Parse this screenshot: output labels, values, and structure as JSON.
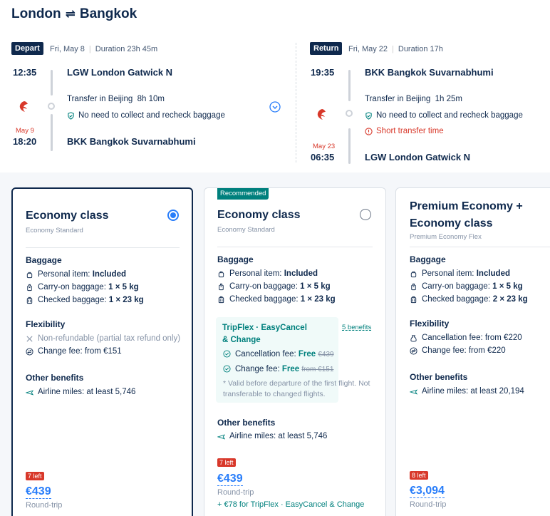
{
  "header": {
    "origin": "London",
    "swap_icon": "⇌",
    "destination": "Bangkok"
  },
  "depart": {
    "tag": "Depart",
    "date": "Fri, May 8",
    "duration": "Duration 23h 45m",
    "dep_time": "12:35",
    "dep_airport": "LGW London Gatwick N",
    "transfer": "Transfer in Beijing",
    "transfer_time": "8h 10m",
    "baggage_note": "No need to collect and recheck baggage",
    "arr_date": "May 9",
    "arr_time": "18:20",
    "arr_airport": "BKK Bangkok Suvarnabhumi"
  },
  "return": {
    "tag": "Return",
    "date": "Fri, May 22",
    "duration": "Duration 17h",
    "dep_time": "19:35",
    "dep_airport": "BKK Bangkok Suvarnabhumi",
    "transfer": "Transfer in Beijing",
    "transfer_time": "1h 25m",
    "baggage_note": "No need to collect and recheck baggage",
    "warning": "Short transfer time",
    "arr_date": "May 23",
    "arr_time": "06:35",
    "arr_airport": "LGW London Gatwick N"
  },
  "fares": [
    {
      "name": "Economy class",
      "subname": "Economy Standard",
      "selected": true,
      "baggage_title": "Baggage",
      "personal_label": "Personal item:",
      "personal_value": "Included",
      "carry_label": "Carry-on baggage:",
      "carry_value": "1 × 5 kg",
      "checked_label": "Checked baggage:",
      "checked_value": "1 × 23 kg",
      "flex_title": "Flexibility",
      "flex_1": "Non-refundable (partial tax refund only)",
      "flex_2": "Change fee: from €151",
      "other_title": "Other benefits",
      "miles": "Airline miles: at least 5,746",
      "seats_left": "7 left",
      "price": "€439",
      "price_note": "Round-trip"
    },
    {
      "name": "Economy class",
      "subname": "Economy Standard",
      "selected": false,
      "badge": "Recommended",
      "baggage_title": "Baggage",
      "personal_label": "Personal item:",
      "personal_value": "Included",
      "carry_label": "Carry-on baggage:",
      "carry_value": "1 × 5 kg",
      "checked_label": "Checked baggage:",
      "checked_value": "1 × 23 kg",
      "tripflex_title": "TripFlex · EasyCancel & Change",
      "tripflex_link": "5 benefits",
      "cancel_label": "Cancellation fee:",
      "cancel_free": "Free",
      "cancel_old": "€439",
      "change_label": "Change fee:",
      "change_free": "Free",
      "change_old": "from €151",
      "tripflex_note": "* Valid before departure of the first flight. Not transferable to changed flights.",
      "other_title": "Other benefits",
      "miles": "Airline miles: at least 5,746",
      "seats_left": "7 left",
      "price": "€439",
      "price_note": "Round-trip",
      "upsell": "+ €78 for TripFlex · EasyCancel & Change"
    },
    {
      "name": "Premium Economy + Economy class",
      "subname": "Premium Economy Flex",
      "selected": false,
      "baggage_title": "Baggage",
      "personal_label": "Personal item:",
      "personal_value": "Included",
      "carry_label": "Carry-on baggage:",
      "carry_value": "1 × 5 kg",
      "checked_label": "Checked baggage:",
      "checked_value": "2 × 23 kg",
      "flex_title": "Flexibility",
      "flex_1": "Cancellation fee: from €220",
      "flex_2": "Change fee: from €220",
      "other_title": "Other benefits",
      "miles": "Airline miles: at least 20,194",
      "seats_left": "8 left",
      "price": "€3,094",
      "price_note": "Round-trip"
    }
  ],
  "colors": {
    "navy": "#0f294d",
    "blue": "#287dfa",
    "red": "#d8382a",
    "teal": "#00807d"
  }
}
